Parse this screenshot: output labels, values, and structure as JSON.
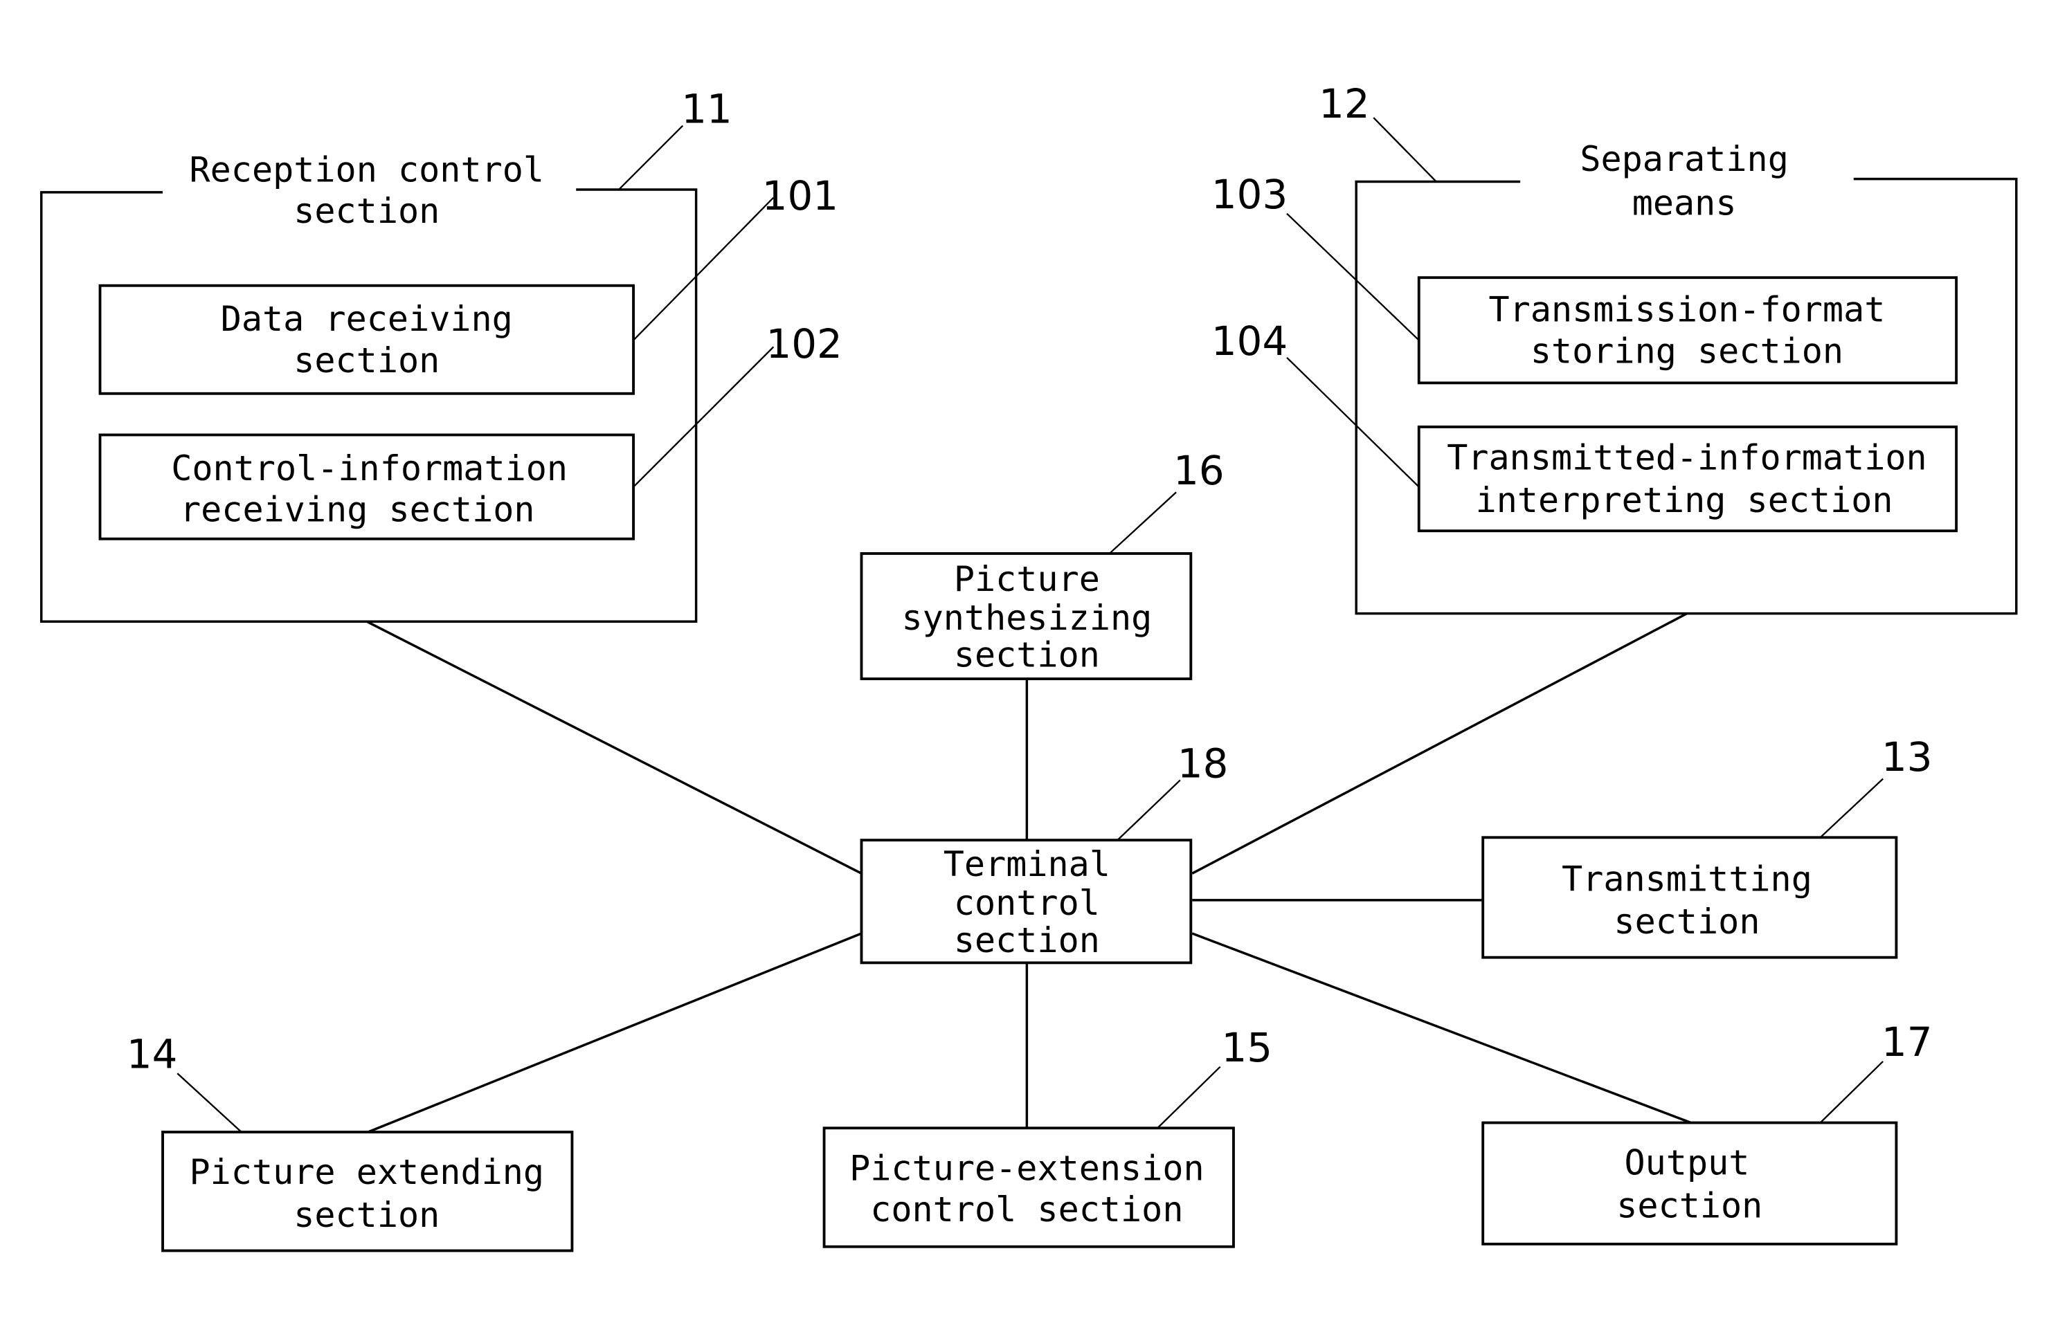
{
  "diagram": {
    "blocks": {
      "reception": {
        "ref": "11",
        "lines": [
          "Reception control",
          "section"
        ]
      },
      "data_receiving": {
        "ref": "101",
        "lines": [
          "Data receiving",
          "section"
        ]
      },
      "control_info_receiving": {
        "ref": "102",
        "lines": [
          "Control-information",
          "receiving section"
        ]
      },
      "separating": {
        "ref": "12",
        "lines": [
          "Separating",
          "means"
        ]
      },
      "transmission_format": {
        "ref": "103",
        "lines": [
          "Transmission-format",
          "storing section"
        ]
      },
      "transmitted_info": {
        "ref": "104",
        "lines": [
          "Transmitted-information",
          "interpreting section"
        ]
      },
      "picture_synth": {
        "ref": "16",
        "lines": [
          "Picture",
          "synthesizing",
          "section"
        ]
      },
      "terminal_control": {
        "ref": "18",
        "lines": [
          "Terminal",
          "control",
          "section"
        ]
      },
      "transmitting": {
        "ref": "13",
        "lines": [
          "Transmitting",
          "section"
        ]
      },
      "picture_extending": {
        "ref": "14",
        "lines": [
          "Picture extending",
          "section"
        ]
      },
      "picture_ext_control": {
        "ref": "15",
        "lines": [
          "Picture-extension",
          "control section"
        ]
      },
      "output": {
        "ref": "17",
        "lines": [
          "Output",
          "section"
        ]
      }
    }
  }
}
